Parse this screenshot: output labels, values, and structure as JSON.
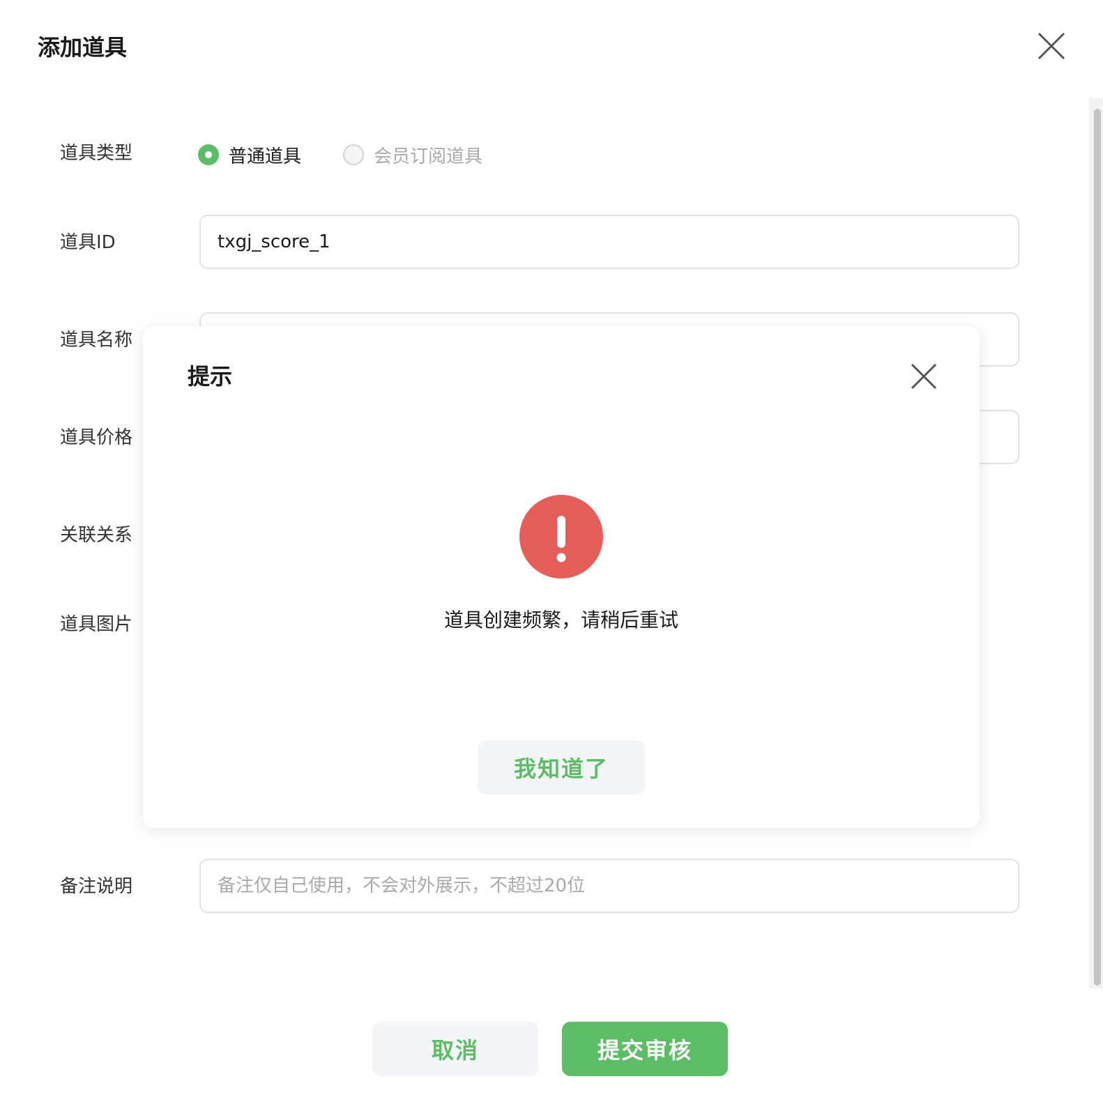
{
  "dialog": {
    "title": "添加道具",
    "close_icon": "close-icon"
  },
  "form": {
    "type": {
      "label": "道具类型",
      "options": [
        {
          "label": "普通道具",
          "checked": true
        },
        {
          "label": "会员订阅道具",
          "checked": false,
          "disabled": true
        }
      ]
    },
    "id": {
      "label": "道具ID",
      "value": "txgj_score_1"
    },
    "name": {
      "label": "道具名称"
    },
    "price": {
      "label": "道具价格"
    },
    "relation": {
      "label": "关联关系"
    },
    "image": {
      "label": "道具图片"
    },
    "remark": {
      "label": "备注说明",
      "placeholder": "备注仅自己使用，不会对外展示，不超过20位"
    }
  },
  "footer": {
    "cancel_label": "取消",
    "submit_label": "提交审核"
  },
  "modal": {
    "title": "提示",
    "icon": "warning-icon",
    "message": "道具创建频繁，请稍后重试",
    "ack_label": "我知道了"
  },
  "colors": {
    "accent": "#5cbd66",
    "warning": "#e55d58",
    "button_bg": "#f4f5f7"
  }
}
